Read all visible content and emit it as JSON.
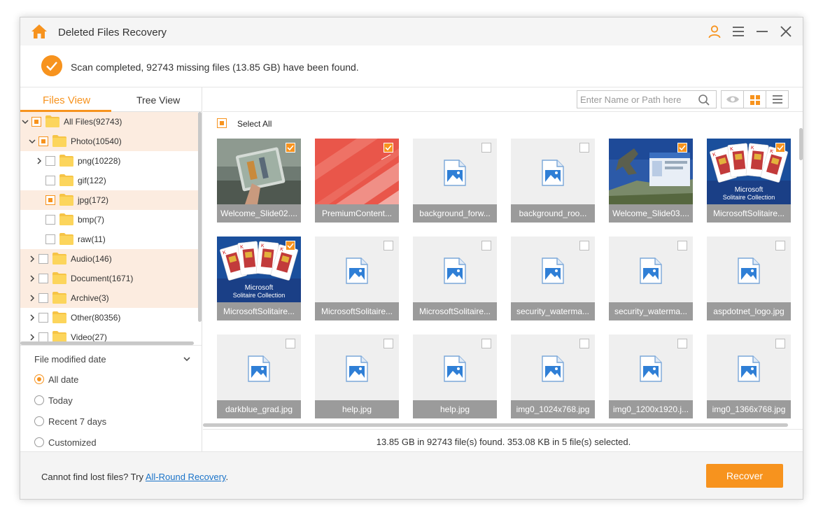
{
  "window": {
    "title": "Deleted Files Recovery"
  },
  "scan": {
    "message": "Scan completed, 92743 missing files (13.85 GB) have been found."
  },
  "left_tabs": [
    {
      "label": "Files View",
      "active": true
    },
    {
      "label": "Tree View",
      "active": false
    }
  ],
  "tree": [
    {
      "label": "All Files(92743)",
      "level": 0,
      "expanded": true,
      "check": "partial",
      "highlight": true
    },
    {
      "label": "Photo(10540)",
      "level": 1,
      "expanded": true,
      "check": "partial",
      "highlight": true
    },
    {
      "label": "png(10228)",
      "level": 2,
      "expanded": false,
      "check": "none",
      "highlight": false
    },
    {
      "label": "gif(122)",
      "level": 2,
      "expanded": null,
      "check": "none",
      "highlight": false
    },
    {
      "label": "jpg(172)",
      "level": 2,
      "expanded": null,
      "check": "partial",
      "highlight": true
    },
    {
      "label": "bmp(7)",
      "level": 2,
      "expanded": null,
      "check": "none",
      "highlight": false
    },
    {
      "label": "raw(11)",
      "level": 2,
      "expanded": null,
      "check": "none",
      "highlight": false
    },
    {
      "label": "Audio(146)",
      "level": 1,
      "expanded": false,
      "check": "none",
      "highlight": true
    },
    {
      "label": "Document(1671)",
      "level": 1,
      "expanded": false,
      "check": "none",
      "highlight": true
    },
    {
      "label": "Archive(3)",
      "level": 1,
      "expanded": false,
      "check": "none",
      "highlight": true
    },
    {
      "label": "Other(80356)",
      "level": 1,
      "expanded": false,
      "check": "none",
      "highlight": false
    },
    {
      "label": "Video(27)",
      "level": 1,
      "expanded": false,
      "check": "none",
      "highlight": false
    }
  ],
  "filter": {
    "title": "File modified date",
    "options": [
      {
        "label": "All date",
        "selected": true
      },
      {
        "label": "Today",
        "selected": false
      },
      {
        "label": "Recent 7 days",
        "selected": false
      },
      {
        "label": "Customized",
        "selected": false
      }
    ]
  },
  "search": {
    "placeholder": "Enter Name or Path here"
  },
  "select_all": {
    "label": "Select All"
  },
  "files": [
    {
      "name": "Welcome_Slide02....",
      "checked": true,
      "thumb": "photo-tablet"
    },
    {
      "name": "PremiumContent...",
      "checked": true,
      "thumb": "photo-red-stripes"
    },
    {
      "name": "background_forw...",
      "checked": false,
      "thumb": "generic"
    },
    {
      "name": "background_roo...",
      "checked": false,
      "thumb": "generic"
    },
    {
      "name": "Welcome_Slide03....",
      "checked": true,
      "thumb": "photo-skydiver"
    },
    {
      "name": "MicrosoftSolitaire...",
      "checked": true,
      "thumb": "photo-solitaire"
    },
    {
      "name": "MicrosoftSolitaire...",
      "checked": true,
      "thumb": "photo-solitaire"
    },
    {
      "name": "MicrosoftSolitaire...",
      "checked": false,
      "thumb": "generic"
    },
    {
      "name": "MicrosoftSolitaire...",
      "checked": false,
      "thumb": "generic"
    },
    {
      "name": "security_waterma...",
      "checked": false,
      "thumb": "generic"
    },
    {
      "name": "security_waterma...",
      "checked": false,
      "thumb": "generic"
    },
    {
      "name": "aspdotnet_logo.jpg",
      "checked": false,
      "thumb": "generic"
    },
    {
      "name": "darkblue_grad.jpg",
      "checked": false,
      "thumb": "generic"
    },
    {
      "name": "help.jpg",
      "checked": false,
      "thumb": "generic"
    },
    {
      "name": "help.jpg",
      "checked": false,
      "thumb": "generic"
    },
    {
      "name": "img0_1024x768.jpg",
      "checked": false,
      "thumb": "generic"
    },
    {
      "name": "img0_1200x1920.j...",
      "checked": false,
      "thumb": "generic"
    },
    {
      "name": "img0_1366x768.jpg",
      "checked": false,
      "thumb": "generic"
    }
  ],
  "solitaire_text": {
    "line1": "Microsoft",
    "line2": "Solitaire Collection"
  },
  "status": {
    "text": "13.85 GB in 92743 file(s) found. 353.08 KB in 5 file(s) selected."
  },
  "footer": {
    "prefix": "Cannot find lost files? Try ",
    "link": "All-Round Recovery",
    "suffix": "."
  },
  "recover": {
    "label": "Recover"
  },
  "colors": {
    "accent": "#f7931e",
    "highlight": "#fcece0",
    "link": "#1a73c9",
    "caption_bg": "#9b9b9b"
  }
}
